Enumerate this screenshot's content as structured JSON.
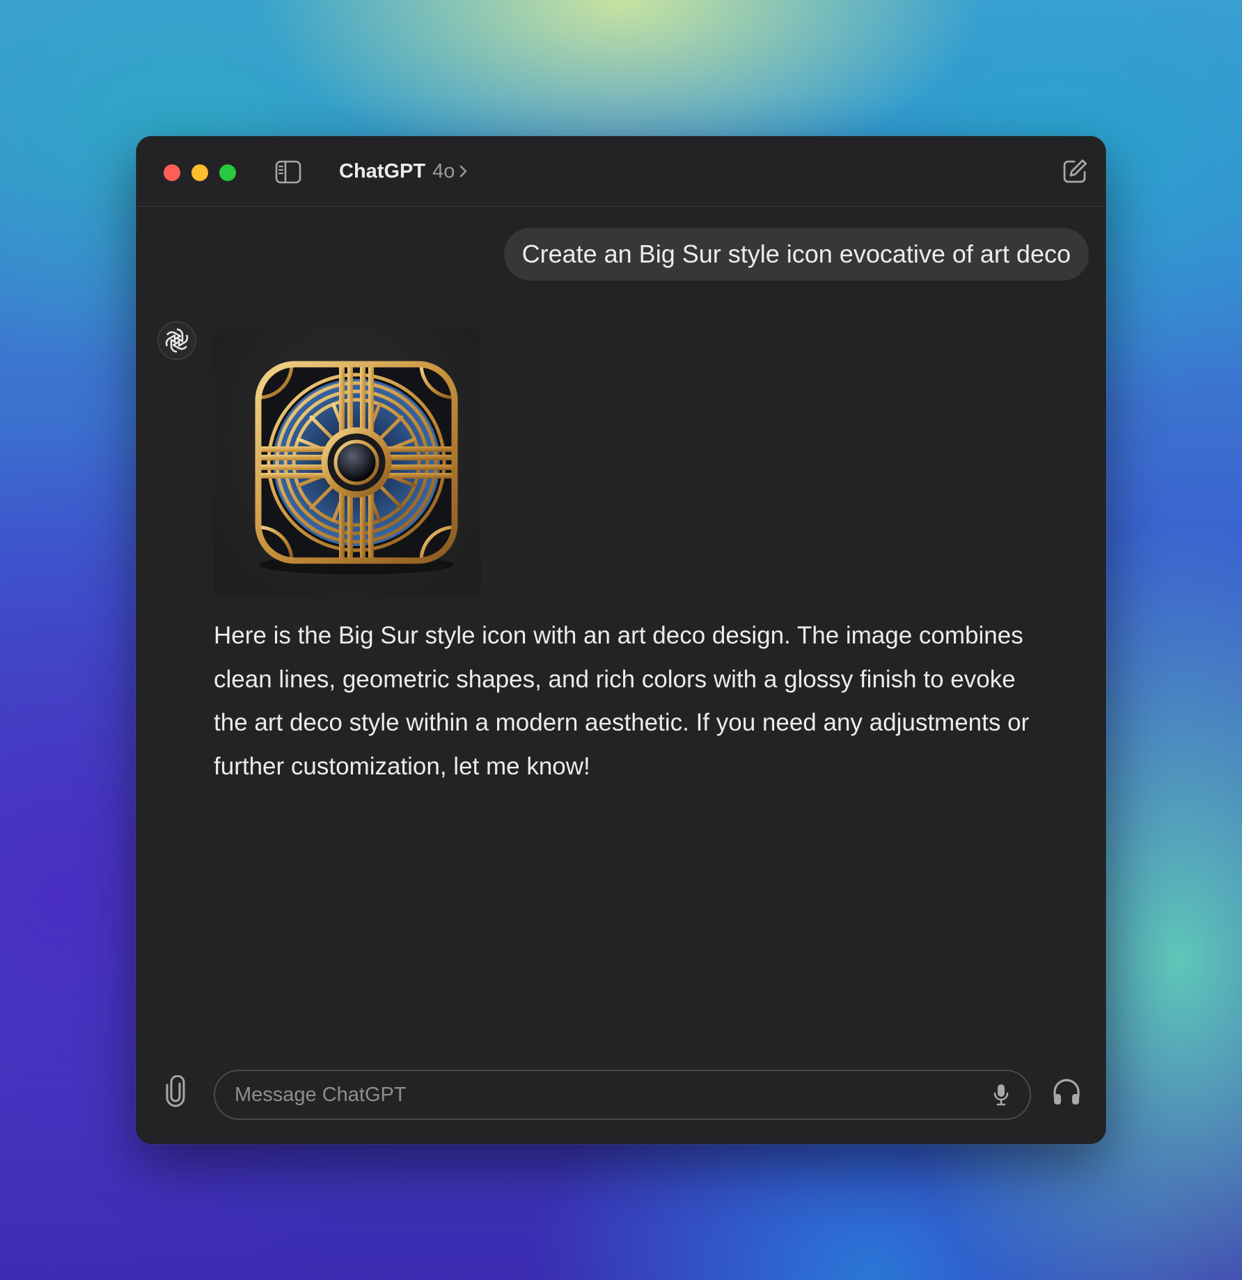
{
  "window": {
    "title": "ChatGPT",
    "model": "4o"
  },
  "icons": {
    "sidebar_toggle": "sidebar-toggle-icon",
    "new_chat": "compose-icon",
    "attach": "paperclip-icon",
    "mic": "microphone-icon",
    "voice": "headphones-icon",
    "avatar": "openai-logo-icon",
    "model_chevron": "chevron-right-icon"
  },
  "colors": {
    "window_bg": "#232325",
    "user_bubble": "#373739",
    "traffic_red": "#ff5f57",
    "traffic_yellow": "#febc2e",
    "traffic_green": "#28c840",
    "gold": "#d4a44a"
  },
  "conversation": {
    "user_message": "Create an Big Sur style icon evocative of art deco",
    "assistant_image_alt": "art deco icon",
    "assistant_message": "Here is the Big Sur style icon with an art deco design. The image combines clean lines, geometric shapes, and rich colors with a glossy finish to evoke the art deco style within a modern aesthetic. If you need any adjustments or further customization, let me know!"
  },
  "composer": {
    "placeholder": "Message ChatGPT",
    "value": ""
  }
}
